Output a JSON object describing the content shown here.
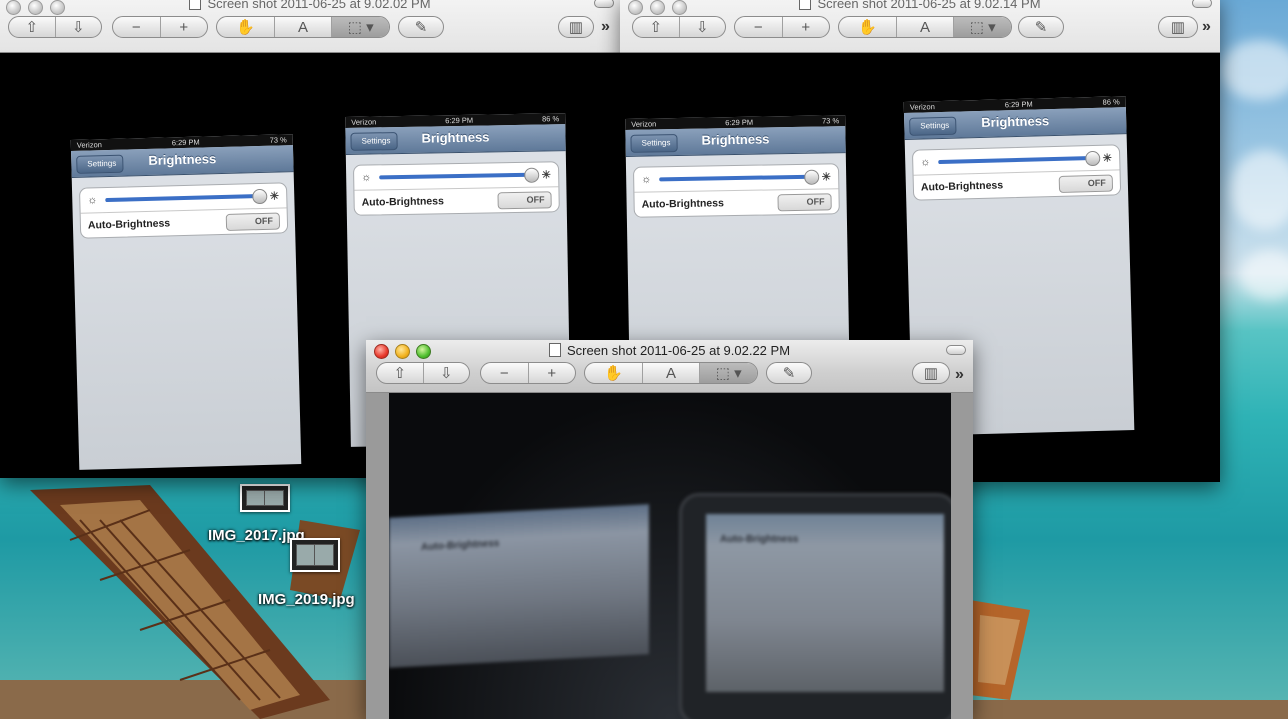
{
  "windows": [
    {
      "title": "Screen shot 2011-06-25 at 9.02.02 PM"
    },
    {
      "title": "Screen shot 2011-06-25 at 9.02.14 PM"
    },
    {
      "title": "Screen shot 2011-06-25 at 9.02.22 PM"
    }
  ],
  "toolbar": {
    "prev_icon": "⇧",
    "next_icon": "⇩",
    "zoom_out": "−",
    "zoom_in": "+",
    "hand_icon": "✋",
    "text_icon": "A",
    "select_icon": "⬚ ▾",
    "annotate_icon": "✎",
    "sidebar_icon": "▥",
    "overflow": "»"
  },
  "phones": [
    {
      "carrier": "Verizon",
      "time": "6:29 PM",
      "battery": "73 %",
      "back": "Settings",
      "title": "Brightness",
      "auto_label": "Auto-Brightness",
      "toggle": "OFF"
    },
    {
      "carrier": "Verizon",
      "time": "6:29 PM",
      "battery": "86 %",
      "back": "Settings",
      "title": "Brightness",
      "auto_label": "Auto-Brightness",
      "toggle": "OFF"
    },
    {
      "carrier": "Verizon",
      "time": "6:29 PM",
      "battery": "73 %",
      "back": "Settings",
      "title": "Brightness",
      "auto_label": "Auto-Brightness",
      "toggle": "OFF"
    },
    {
      "carrier": "Verizon",
      "time": "6:29 PM",
      "battery": "86 %",
      "back": "Settings",
      "title": "Brightness",
      "auto_label": "Auto-Brightness",
      "toggle": "OFF"
    }
  ],
  "blurry_photo": {
    "left_label": "Auto-Brightness",
    "right_label": "Auto-Brightness"
  },
  "desktop": {
    "icons": [
      {
        "label": "IMG_2017.jpg"
      },
      {
        "label": "IMG_2019.jpg"
      }
    ]
  }
}
